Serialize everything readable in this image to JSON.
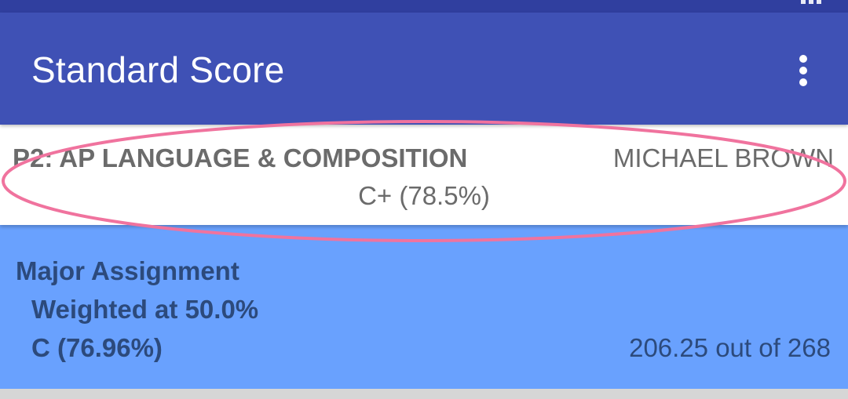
{
  "app_bar": {
    "title": "Standard Score",
    "menu_icon": "more-vert-icon"
  },
  "course": {
    "name": "P2: AP LANGUAGE & COMPOSITION",
    "teacher": "MICHAEL BROWN",
    "grade": "C+ (78.5%)"
  },
  "category": {
    "name": "Major Assignment",
    "weight": "Weighted at 50.0%",
    "grade": "C (76.96%)",
    "points": "206.25 out of 268"
  },
  "colors": {
    "status_bar": "#303f9f",
    "app_bar": "#3f51b5",
    "category_bg": "#69a1fe",
    "highlight": "#f0739e"
  }
}
